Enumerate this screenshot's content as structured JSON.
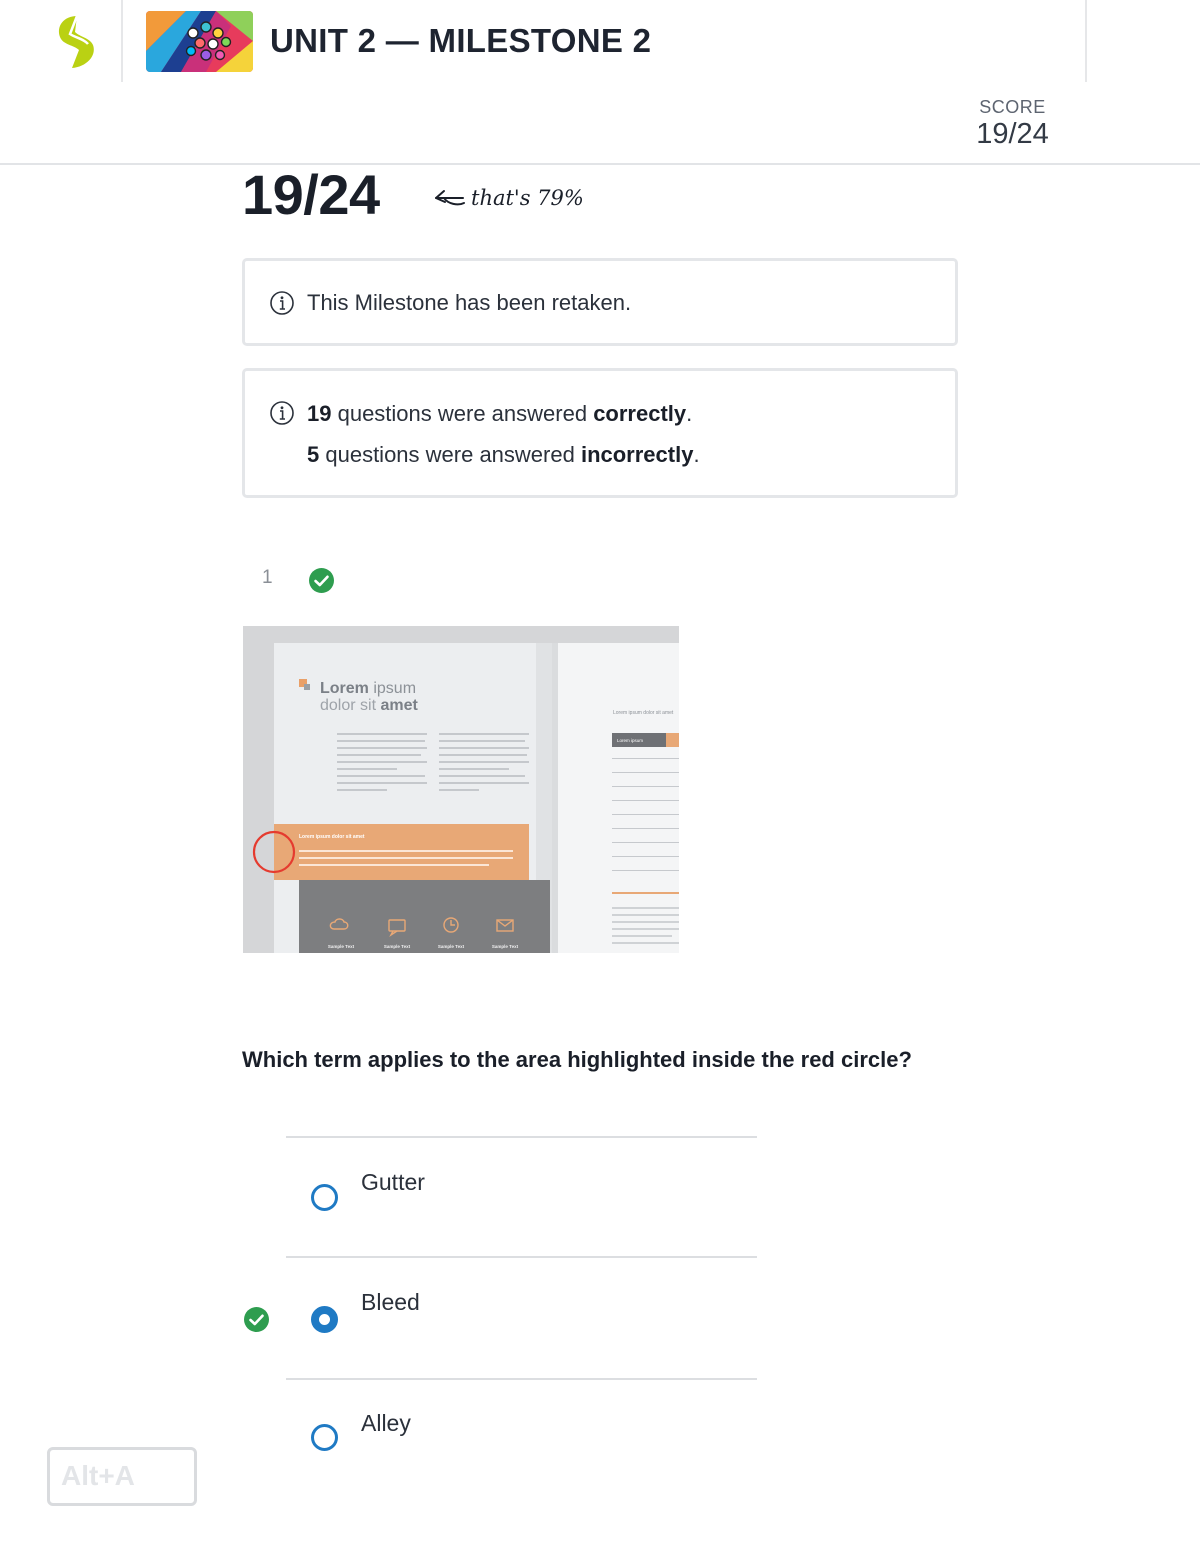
{
  "header": {
    "unit_title": "UNIT 2 — MILESTONE 2",
    "score_label": "SCORE",
    "score_value": "19/24",
    "logo_color": "#b9d214"
  },
  "result": {
    "big_score": "19/24",
    "percent_note": "that's 79%"
  },
  "notices": {
    "retaken": "This Milestone has been retaken.",
    "correct_count": "19",
    "correct_mid": " questions were answered ",
    "correct_word": "correctly",
    "incorrect_count": "5",
    "incorrect_mid": " questions were answered ",
    "incorrect_word": "incorrectly",
    "period": "."
  },
  "question": {
    "number": "1",
    "status": "correct",
    "prompt": "Which term applies to the area highlighted inside the red circle?",
    "image_text": {
      "heading_bold": "Lorem",
      "heading_light": " ipsum",
      "subheading_light": "dolor sit ",
      "subheading_bold": "amet",
      "band_title": "Lorem ipsum dolor sit amet",
      "right_title": "Lorem ipsum dolor sit amet",
      "table_header": "Lorem ipsum",
      "sample": "Sample Text"
    },
    "options": [
      {
        "label": "Gutter",
        "selected": false
      },
      {
        "label": "Bleed",
        "selected": true,
        "marked_correct": true
      },
      {
        "label": "Alley",
        "selected": false
      }
    ]
  },
  "shortcut": {
    "label": "Alt+A"
  },
  "colors": {
    "accent_blue": "#1f7ac4",
    "success_green": "#2e9d4f",
    "highlight_orange": "#e8a876",
    "circle_red": "#e53b2f"
  }
}
